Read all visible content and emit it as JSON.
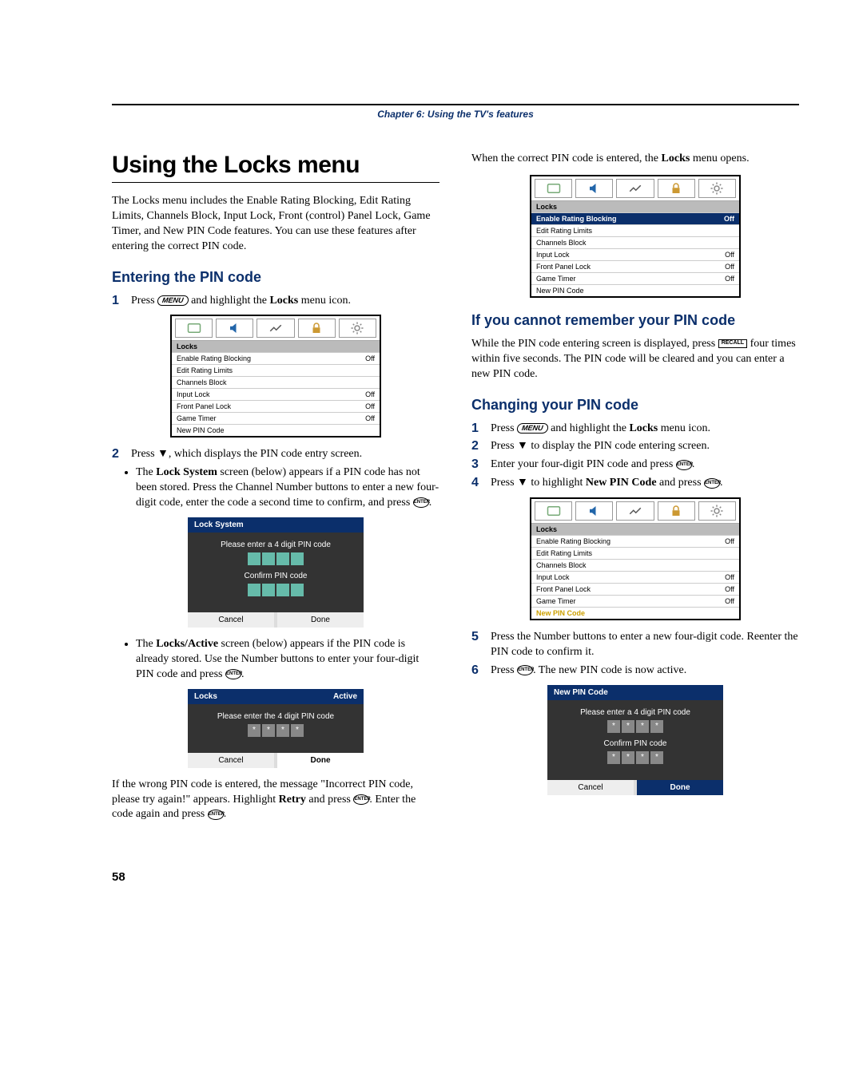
{
  "chapter": "Chapter 6: Using the TV's features",
  "title": "Using the Locks menu",
  "intro": "The Locks menu includes the Enable Rating Blocking, Edit Rating Limits, Channels Block, Input Lock, Front (control) Panel Lock, Game Timer, and New PIN Code features. You can use these features after entering the correct PIN code.",
  "sec1": {
    "heading": "Entering the PIN code",
    "step1_a": "Press ",
    "step1_b": " and highlight the ",
    "step1_locks": "Locks",
    "step1_c": " menu icon.",
    "step2": "Press ▼, which displays the PIN code entry screen.",
    "bullet1_a": "The ",
    "bullet1_b": "Lock System",
    "bullet1_c": " screen (below) appears if a PIN code has not been stored. Press the Channel Number buttons to enter a new four-digit code, enter the code a second time to confirm, and press ",
    "bullet1_d": ".",
    "bullet2_a": "The ",
    "bullet2_b": "Locks/Active",
    "bullet2_c": " screen (below) appears if the PIN code is already stored. Use the Number buttons to enter your four-digit PIN code and press ",
    "bullet2_d": ".",
    "wrong_a": "If the wrong PIN code is entered, the message \"Incorrect PIN code, please try again!\" appears. Highlight ",
    "wrong_b": "Retry",
    "wrong_c": " and press ",
    "wrong_d": ". Enter the code again and press ",
    "wrong_e": "."
  },
  "right_top": {
    "line_a": "When the correct PIN code is entered, the ",
    "line_b": "Locks",
    "line_c": " menu opens."
  },
  "sec2": {
    "heading": "If you cannot remember your PIN code",
    "body_a": "While the PIN code entering screen is displayed, press ",
    "body_b": " four times within five seconds. The PIN code will be cleared and you can enter a new PIN code."
  },
  "sec3": {
    "heading": "Changing your PIN code",
    "s1_a": "Press ",
    "s1_b": " and highlight the ",
    "s1_c": "Locks",
    "s1_d": " menu icon.",
    "s2": "Press ▼ to display the PIN code entering screen.",
    "s3_a": "Enter your four-digit PIN code and press ",
    "s3_b": ".",
    "s4_a": "Press ▼ to highlight ",
    "s4_b": "New PIN Code",
    "s4_c": " and press ",
    "s4_d": ".",
    "s5": "Press the Number buttons to enter a new four-digit code. Reenter the PIN code to confirm it.",
    "s6_a": "Press ",
    "s6_b": ". The new PIN code is now active."
  },
  "menu": {
    "header": "Locks",
    "rows": [
      {
        "label": "Enable Rating Blocking",
        "val": "Off"
      },
      {
        "label": "Edit Rating Limits",
        "val": ""
      },
      {
        "label": "Channels Block",
        "val": ""
      },
      {
        "label": "Input Lock",
        "val": "Off"
      },
      {
        "label": "Front Panel Lock",
        "val": "Off"
      },
      {
        "label": "Game Timer",
        "val": "Off"
      },
      {
        "label": "New PIN Code",
        "val": ""
      }
    ]
  },
  "lock_system": {
    "title": "Lock System",
    "msg1": "Please enter a 4 digit PIN code",
    "msg2": "Confirm PIN code",
    "cancel": "Cancel",
    "done": "Done"
  },
  "locks_active": {
    "title": "Locks",
    "right": "Active",
    "msg": "Please enter the 4 digit PIN code",
    "cancel": "Cancel",
    "done": "Done"
  },
  "newpin": {
    "title": "New PIN Code",
    "msg1": "Please enter a 4 digit PIN code",
    "msg2": "Confirm PIN code",
    "cancel": "Cancel",
    "done": "Done"
  },
  "keys": {
    "menu": "MENU",
    "enter": "ENTER",
    "recall": "RECALL"
  },
  "page_number": "58"
}
